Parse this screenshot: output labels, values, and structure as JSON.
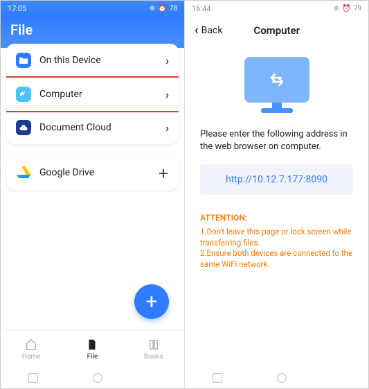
{
  "left": {
    "status_time": "17:05",
    "status_right": "78",
    "title": "File",
    "rows": [
      {
        "label": "On this Device",
        "icon": "folder",
        "action": "chevron"
      },
      {
        "label": "Computer",
        "icon": "computer",
        "action": "chevron",
        "highlighted": true
      },
      {
        "label": "Document Cloud",
        "icon": "cloud",
        "action": "chevron"
      }
    ],
    "single_row": {
      "label": "Google Drive",
      "icon": "drive",
      "action": "plus"
    },
    "tabs": [
      {
        "label": "Home",
        "icon": "home"
      },
      {
        "label": "File",
        "icon": "file",
        "active": true
      },
      {
        "label": "Books",
        "icon": "books"
      }
    ],
    "fab_label": "+"
  },
  "right": {
    "status_time": "16:44",
    "status_right": "79",
    "back": "Back",
    "title": "Computer",
    "instructions": "Please enter the following address in the web browser on computer.",
    "url": "http://10.12.7.177:8090",
    "attention_label": "ATTENTION:",
    "tips": [
      "1.Don't leave this page or lock screen while transferring files.",
      "2.Ensure both devices are connected to the same WiFi network."
    ]
  }
}
